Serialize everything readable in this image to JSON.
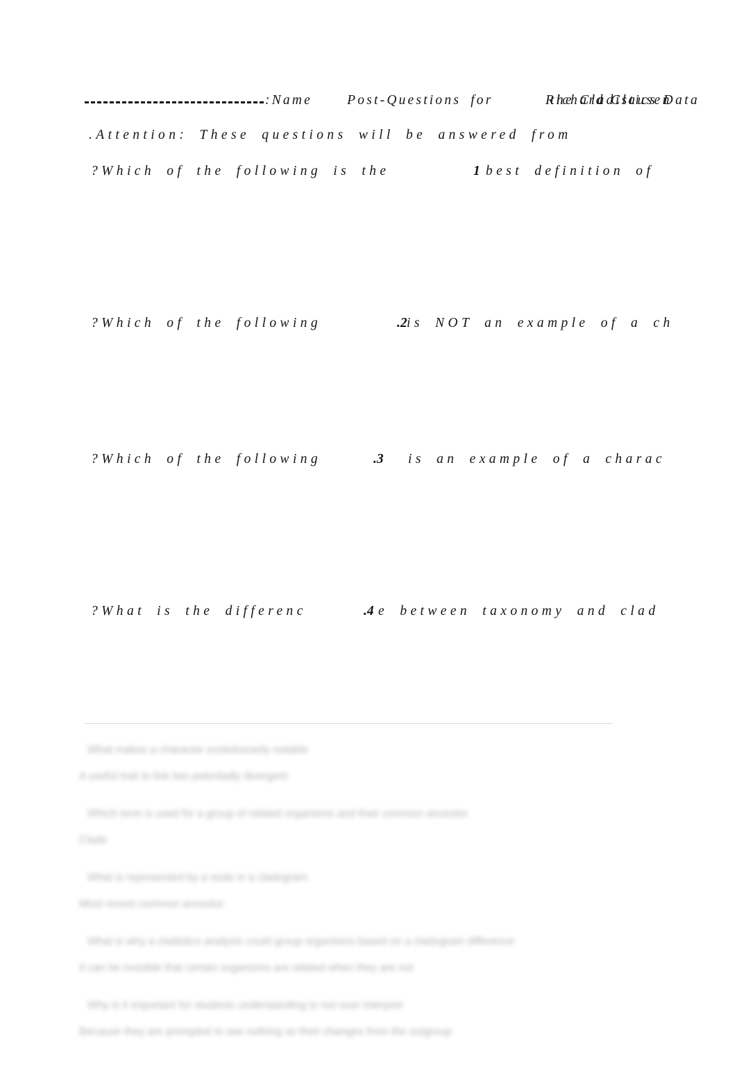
{
  "document": {
    "type": "worksheet",
    "header": {
      "name_rule": "_______________",
      "name_label": ":Name",
      "title_text": "Post-Questions for",
      "title_tail_a": "Richard Clausen",
      "title_tail_b": "the Cladistics Data",
      "attention_line": ".Attention: These questions will be answered from"
    },
    "questions": [
      {
        "number": "1",
        "number_mark": ".1",
        "text_before": "?Which of the following is the",
        "text_after": "best definition of"
      },
      {
        "number": "2",
        "number_mark": ".2",
        "text_before": "?Which of the following",
        "text_after": "is NOT an example of a ch"
      },
      {
        "number": "3",
        "number_mark": ".3",
        "text_before": "?Which of the following",
        "text_after": "is an example of a charac"
      },
      {
        "number": "4",
        "number_mark": ".4",
        "text_before": "?What is the differenc",
        "text_after": "e between taxonomy and clad"
      }
    ],
    "answer_key": {
      "blocks": [
        {
          "question": "What makes a character evolutionarily notable",
          "answer": "A useful trait to link two potentially divergent"
        },
        {
          "question": "Which term is used for a group of related organisms and their common ancestor",
          "answer": "Clade"
        },
        {
          "question": "What is represented by a node in a cladogram",
          "answer": "Most recent common ancestor"
        },
        {
          "question": "What is why a cladistics analysis could group organisms based on a cladogram difference",
          "answer": "It can be invisible that certain organisms are related when they are not"
        },
        {
          "question": "Why is it important for students understanding to not over interpret",
          "answer": "Because they are prompted to see nothing so their changes from the outgroup"
        }
      ]
    }
  }
}
